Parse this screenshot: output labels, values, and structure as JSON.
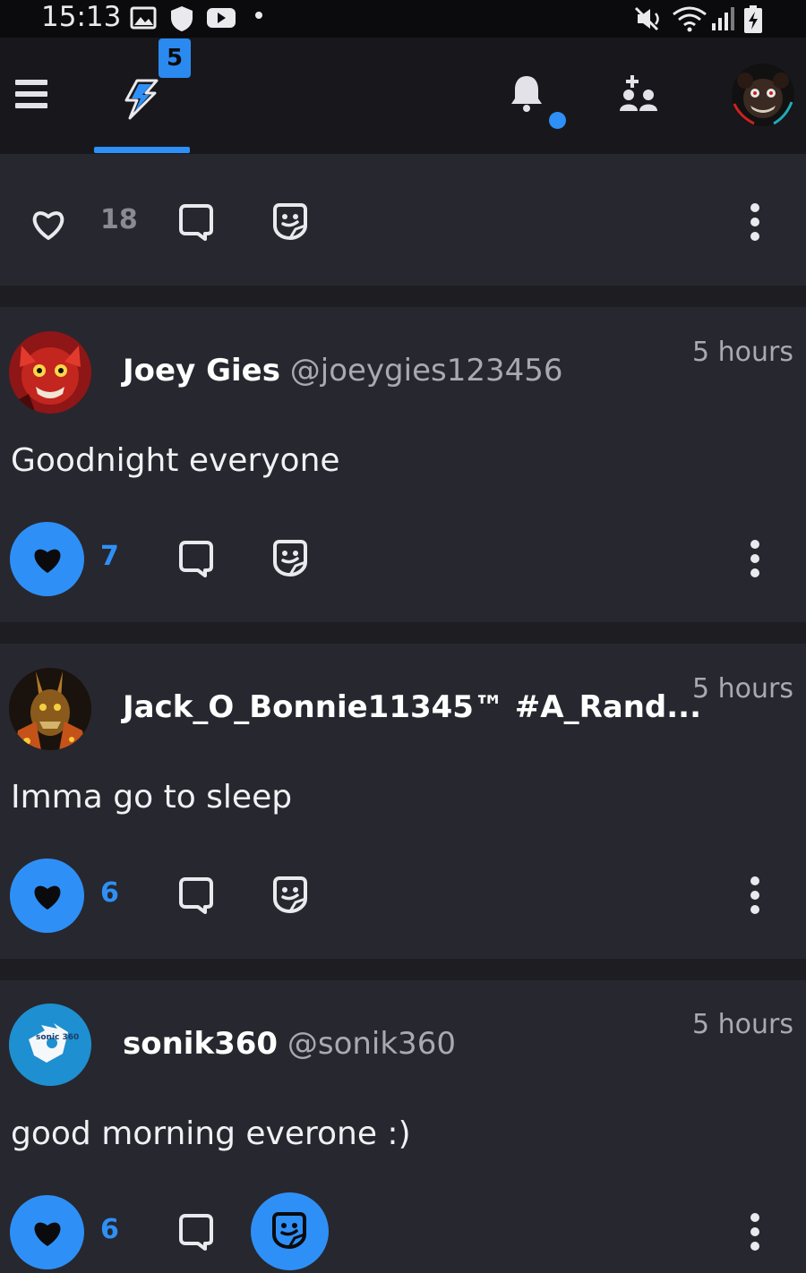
{
  "status_bar": {
    "time": "15:13",
    "icons": [
      "image-icon",
      "shield-icon",
      "youtube-icon",
      "dot-icon",
      "mute-icon",
      "wifi-icon",
      "signal-icon",
      "battery-charging-icon"
    ]
  },
  "nav": {
    "icons": [
      "menu-icon",
      "lightning-icon",
      "bell-icon",
      "add-friend-icon",
      "profile-avatar"
    ],
    "badge": "5",
    "accent": "#2e90f6"
  },
  "top_card": {
    "like_count": "18"
  },
  "posts": [
    {
      "name": "Joey Gies",
      "handle": "@joeygies123456",
      "time": "5 hours",
      "text": "Goodnight everyone",
      "likes": "7"
    },
    {
      "name": "Jack_O_Bonnie11345™ #A_Rand...",
      "handle": "",
      "time": "5 hours",
      "text": "Imma go to sleep",
      "likes": "6"
    },
    {
      "name": "sonik360",
      "handle": "@sonik360",
      "time": "5 hours",
      "text": "good morning everone :)",
      "likes": "6",
      "avatar_text": "sonic 360"
    }
  ]
}
